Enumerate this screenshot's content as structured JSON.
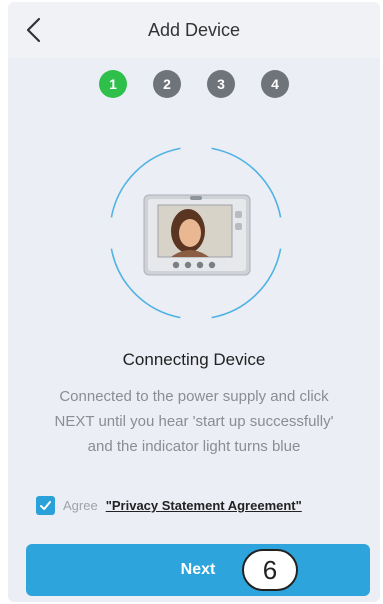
{
  "header": {
    "title": "Add Device"
  },
  "steps": [
    "1",
    "2",
    "3",
    "4"
  ],
  "content": {
    "title": "Connecting Device",
    "description_lines": [
      "Connected to the power supply and click",
      "NEXT until you hear 'start up successfully'",
      "and the indicator light turns blue"
    ]
  },
  "agree": {
    "label": "Agree",
    "link": "\"Privacy Statement Agreement\""
  },
  "next": {
    "label": "Next",
    "callout": "6"
  },
  "colors": {
    "accent": "#2ea4dc",
    "step_active": "#2fbf4b",
    "step_inactive": "#6f737a",
    "background": "#eceef5"
  }
}
